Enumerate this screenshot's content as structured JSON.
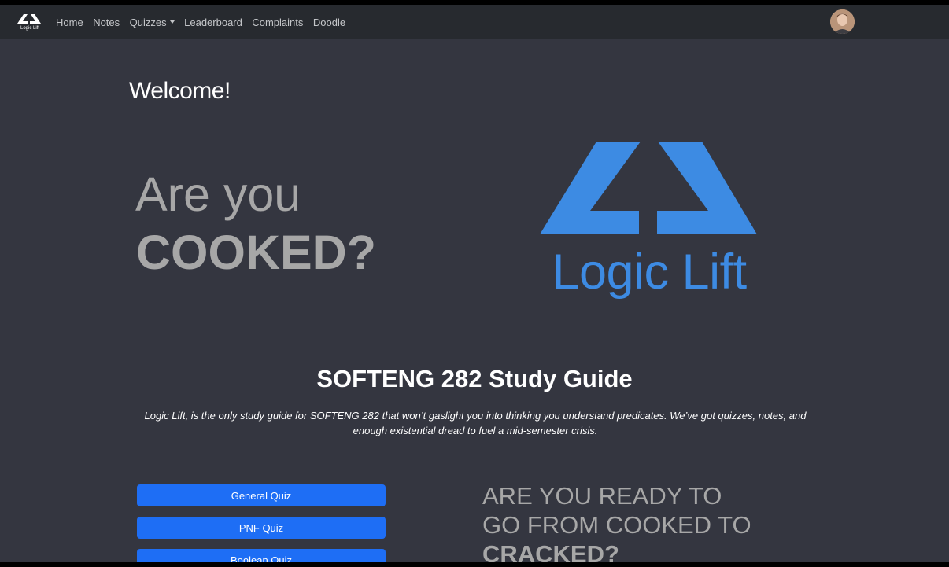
{
  "nav": {
    "brand_text": "Logic Lift",
    "links": [
      "Home",
      "Notes",
      "Quizzes",
      "Leaderboard",
      "Complaints",
      "Doodle"
    ]
  },
  "main": {
    "welcome": "Welcome!",
    "hero_line1": "Are you",
    "hero_line2": "COOKED?",
    "logo_text": "Logic Lift",
    "guide_title": "SOFTENG 282 Study Guide",
    "guide_description": "Logic Lift, is the only study guide for SOFTENG 282 that won’t gaslight you into thinking you understand predicates. We’ve got quizzes, notes, and enough existential dread to fuel a mid-semester crisis.",
    "quiz_buttons": [
      "General Quiz",
      "PNF Quiz",
      "Boolean Quiz"
    ],
    "ready_line1": "ARE YOU READY TO",
    "ready_line2": "GO FROM COOKED TO",
    "ready_line3": "CRACKED?"
  },
  "colors": {
    "page_bg": "#343640",
    "navbar_bg": "#272a2f",
    "brand_blue": "#3d8be3",
    "button_blue": "#1e6ef5",
    "hero_gray": "#a7a7a7"
  },
  "icons": [
    "logic-lift-logo-icon",
    "caret-down-icon",
    "user-avatar"
  ]
}
